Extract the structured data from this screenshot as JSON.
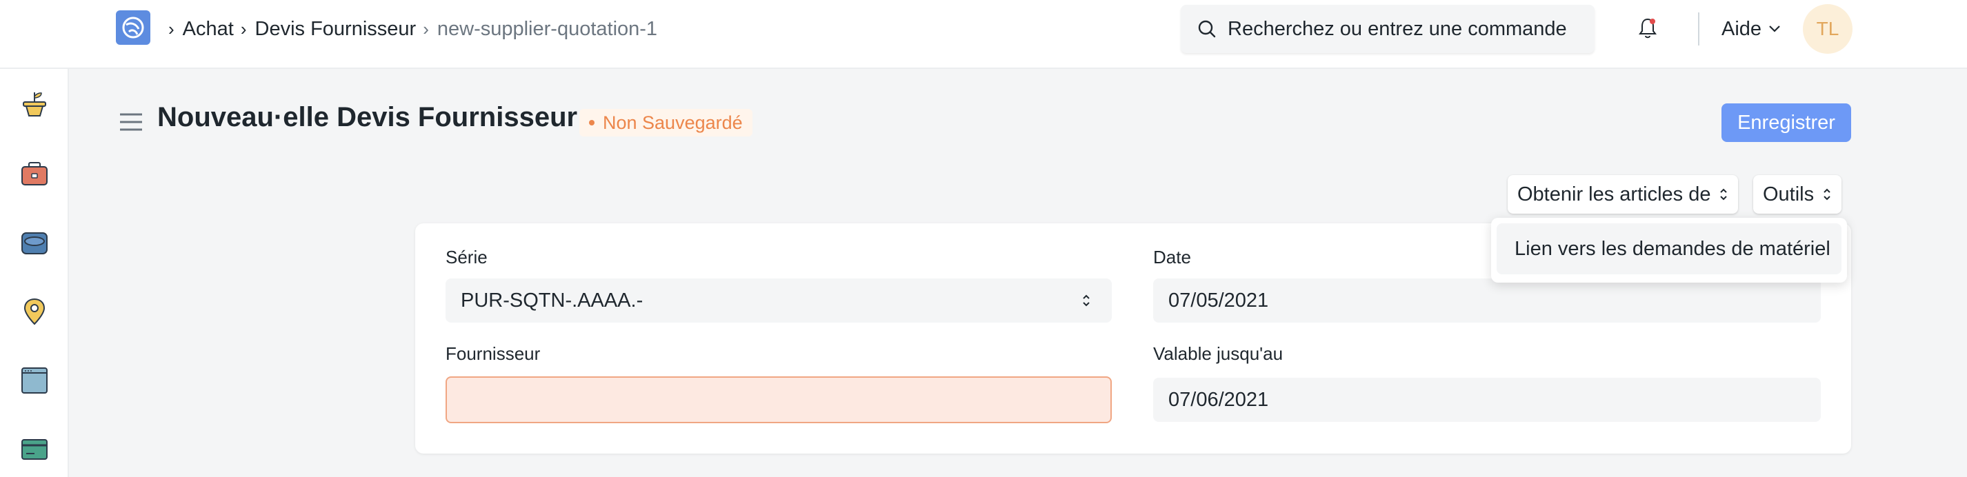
{
  "navbar": {
    "logo_icon": "frappe-logo-icon",
    "breadcrumbs": [
      {
        "label": "Achat"
      },
      {
        "label": "Devis Fournisseur"
      },
      {
        "label": "new-supplier-quotation-1"
      }
    ],
    "search": {
      "placeholder": "Recherchez ou entrez une commande",
      "icon": "search-icon"
    },
    "notifications_icon": "bell-icon",
    "help_label": "Aide",
    "avatar_initials": "TL"
  },
  "sidebar": {
    "items": [
      {
        "icon": "plant-pot-icon"
      },
      {
        "icon": "briefcase-icon"
      },
      {
        "icon": "database-icon"
      },
      {
        "icon": "map-pin-icon"
      },
      {
        "icon": "browser-window-icon"
      },
      {
        "icon": "credit-card-icon"
      }
    ]
  },
  "page": {
    "title": "Nouveau·elle Devis Fournisseur",
    "status": "Non Sauvegardé",
    "save_label": "Enregistrer",
    "get_items_label": "Obtenir les articles de",
    "tools_label": "Outils"
  },
  "dropdown": {
    "items": [
      {
        "label": "Lien vers les demandes de matériel"
      }
    ]
  },
  "form": {
    "series": {
      "label": "Série",
      "value": "PUR-SQTN-.AAAA.-"
    },
    "date": {
      "label": "Date",
      "value": "07/05/2021"
    },
    "supplier": {
      "label": "Fournisseur",
      "value": ""
    },
    "valid_till": {
      "label": "Valable jusqu'au",
      "value": "07/06/2021"
    }
  },
  "colors": {
    "primary": "#6d99f6",
    "status_orange": "#ec864b",
    "error_background": "#fde9e1"
  }
}
